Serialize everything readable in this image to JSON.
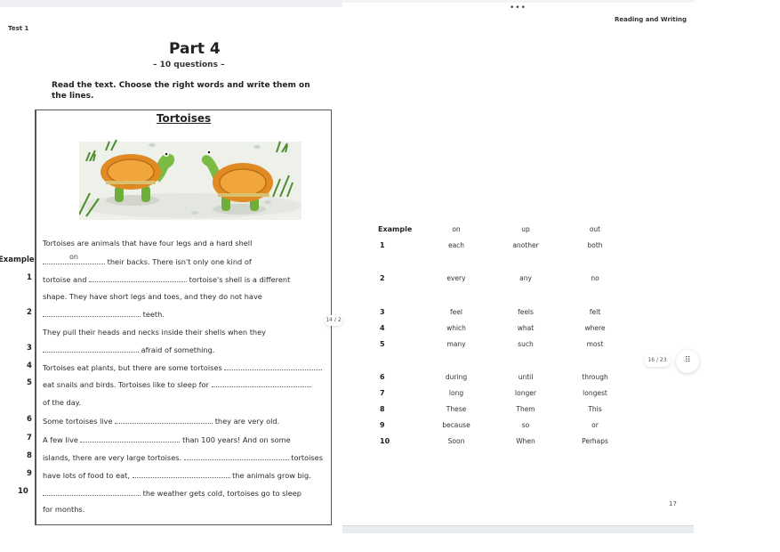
{
  "viewer": {
    "menu_icon": "more-horizontal-icon",
    "menu_glyph": "•••",
    "page_indicator_left": "14 / 2",
    "page_indicator_right": "16 / 23",
    "grid_icon": "grid-dots-icon",
    "grid_glyph": "⠿"
  },
  "left_page": {
    "header": "Test 1",
    "part_title": "Part 4",
    "part_subtitle": "– 10 questions –",
    "instructions": "Read the text. Choose the right words and write them on the lines.",
    "text_title": "Tortoises",
    "illustration": "two-cartoon-tortoises",
    "lines": [
      {
        "num": "",
        "before": "Tortoises are animals that have four legs and a hard shell",
        "blank": false
      },
      {
        "num": "Example",
        "before": "",
        "fill": "on",
        "after": " their backs. There isn't only one kind of",
        "blank": true
      },
      {
        "num": "1",
        "before": "tortoise and ",
        "fill": "",
        "after": " tortoise's shell is a different",
        "blank": true
      },
      {
        "num": "",
        "before": "shape. They have short legs and toes, and they do not have",
        "blank": false
      },
      {
        "num": "2",
        "before": "",
        "fill": "",
        "after": " teeth.",
        "blank": true
      },
      {
        "num": "",
        "before": "They pull their heads and necks inside their shells when they",
        "blank": false
      },
      {
        "num": "3",
        "before": "",
        "fill": "",
        "after": " afraid of something.",
        "blank": true
      },
      {
        "num": "4",
        "before": "Tortoises eat plants, but there are some tortoises ",
        "fill": "",
        "after": "",
        "blank": true
      },
      {
        "num": "5",
        "before": "eat snails and birds. Tortoises like to sleep for ",
        "fill": "",
        "after": "",
        "blank": true
      },
      {
        "num": "",
        "before": "of the day.",
        "blank": false
      },
      {
        "num": "6",
        "before": "Some tortoises live ",
        "fill": "",
        "after": " they are very old.",
        "blank": true
      },
      {
        "num": "7",
        "before": "A few live ",
        "fill": "",
        "after": " than 100 years! And on some",
        "blank": true
      },
      {
        "num": "8",
        "before": "islands, there are very large tortoises. ",
        "fill": "",
        "after": " tortoises",
        "blank": true
      },
      {
        "num": "9",
        "before": "have lots of food to eat, ",
        "fill": "",
        "after": " the animals grow big.",
        "blank": true
      },
      {
        "num": "10",
        "before": "",
        "fill": "",
        "after": " the weather gets cold, tortoises go to sleep",
        "blank": true
      },
      {
        "num": "",
        "before": "for months.",
        "blank": false
      }
    ]
  },
  "right_page": {
    "header": "Reading and Writing",
    "page_number": "17",
    "options": [
      {
        "num": "Example",
        "choices": [
          "on",
          "up",
          "out"
        ]
      },
      {
        "num": "1",
        "choices": [
          "each",
          "another",
          "both"
        ]
      },
      {
        "num": "2",
        "choices": [
          "every",
          "any",
          "no"
        ]
      },
      {
        "num": "3",
        "choices": [
          "feel",
          "feels",
          "felt"
        ]
      },
      {
        "num": "4",
        "choices": [
          "which",
          "what",
          "where"
        ]
      },
      {
        "num": "5",
        "choices": [
          "many",
          "such",
          "most"
        ]
      },
      {
        "num": "6",
        "choices": [
          "during",
          "until",
          "through"
        ]
      },
      {
        "num": "7",
        "choices": [
          "long",
          "longer",
          "longest"
        ]
      },
      {
        "num": "8",
        "choices": [
          "These",
          "Them",
          "This"
        ]
      },
      {
        "num": "9",
        "choices": [
          "because",
          "so",
          "or"
        ]
      },
      {
        "num": "10",
        "choices": [
          "Soon",
          "When",
          "Perhaps"
        ]
      }
    ]
  }
}
